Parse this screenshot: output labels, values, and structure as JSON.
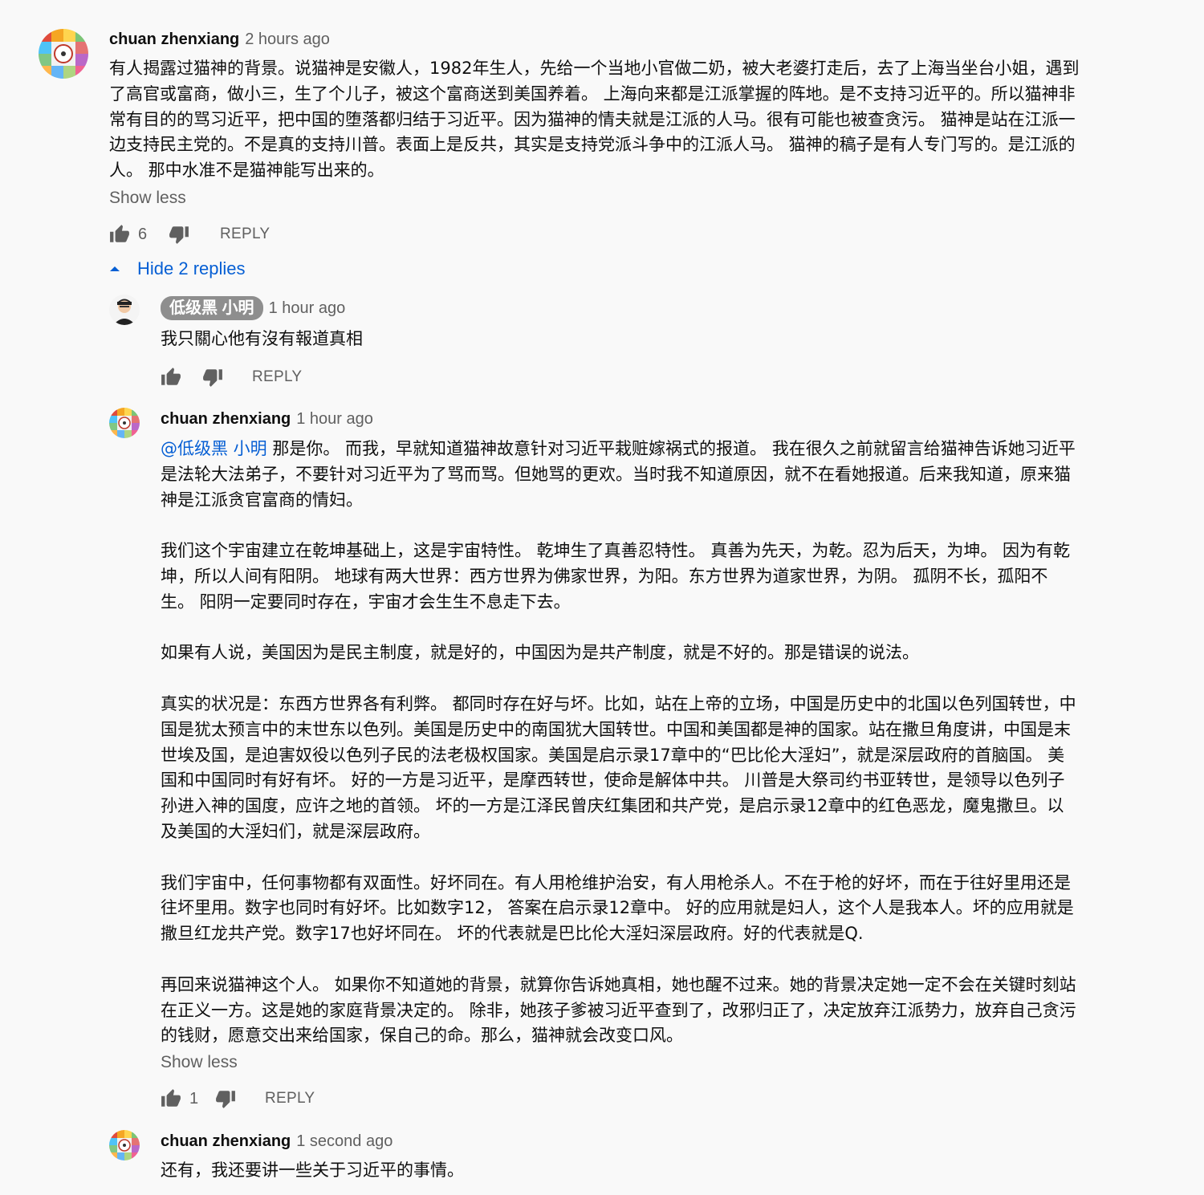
{
  "comment": {
    "author": "chuan zhenxiang",
    "time": "2 hours ago",
    "paragraphs": [
      "有人揭露过猫神的背景。说猫神是安徽人，1982年生人，先给一个当地小官做二奶，被大老婆打走后，去了上海当坐台小姐，遇到了高官或富商，做小三，生了个儿子，被这个富商送到美国养着。 上海向来都是江派掌握的阵地。是不支持习近平的。所以猫神非常有目的的骂习近平，把中国的堕落都归结于习近平。因为猫神的情夫就是江派的人马。很有可能也被查贪污。 猫神是站在江派一边支持民主党的。不是真的支持川普。表面上是反共，其实是支持党派斗争中的江派人马。 猫神的稿子是有人专门写的。是江派的人。 那中水准不是猫神能写出来的。"
    ],
    "show_less": "Show less",
    "likes": "6",
    "reply_label": "REPLY"
  },
  "replies_toggle": {
    "label": "Hide 2 replies"
  },
  "reply1": {
    "author": "低级黑 小明",
    "time": "1 hour ago",
    "text": "我只關心他有沒有報道真相",
    "reply_label": "REPLY"
  },
  "reply2": {
    "author": "chuan zhenxiang",
    "time": "1 hour ago",
    "mention": "@低级黑 小明",
    "p1": " 那是你。 而我，早就知道猫神故意针对习近平栽赃嫁祸式的报道。 我在很久之前就留言给猫神告诉她习近平是法轮大法弟子，不要针对习近平为了骂而骂。但她骂的更欢。当时我不知道原因，就不在看她报道。后来我知道，原来猫神是江派贪官富商的情妇。",
    "p2": "我们这个宇宙建立在乾坤基础上，这是宇宙特性。 乾坤生了真善忍特性。 真善为先天，为乾。忍为后天，为坤。 因为有乾坤，所以人间有阳阴。 地球有两大世界：西方世界为佛家世界，为阳。东方世界为道家世界，为阴。 孤阴不长，孤阳不生。 阳阴一定要同时存在，宇宙才会生生不息走下去。",
    "p3": "如果有人说，美国因为是民主制度，就是好的，中国因为是共产制度，就是不好的。那是错误的说法。",
    "p4": "真实的状况是：东西方世界各有利弊。 都同时存在好与坏。比如，站在上帝的立场，中国是历史中的北国以色列国转世，中国是犹太预言中的末世东以色列。美国是历史中的南国犹大国转世。中国和美国都是神的国家。站在撒旦角度讲，中国是末世埃及国，是迫害奴役以色列子民的法老极权国家。美国是启示录17章中的“巴比伦大淫妇”，就是深层政府的首脑国。 美国和中国同时有好有坏。 好的一方是习近平，是摩西转世，使命是解体中共。 川普是大祭司约书亚转世，是领导以色列子孙进入神的国度，应许之地的首领。 坏的一方是江泽民曾庆红集团和共产党，是启示录12章中的红色恶龙，魔鬼撒旦。以及美国的大淫妇们，就是深层政府。",
    "p5": "我们宇宙中，任何事物都有双面性。好坏同在。有人用枪维护治安，有人用枪杀人。不在于枪的好坏，而在于往好里用还是往坏里用。数字也同时有好坏。比如数字12， 答案在启示录12章中。 好的应用就是妇人，这个人是我本人。坏的应用就是撒旦红龙共产党。数字17也好坏同在。 坏的代表就是巴比伦大淫妇深层政府。好的代表就是Q.",
    "p6": "再回来说猫神这个人。 如果你不知道她的背景，就算你告诉她真相，她也醒不过来。她的背景决定她一定不会在关键时刻站在正义一方。这是她的家庭背景决定的。 除非，她孩子爹被习近平查到了，改邪归正了，决定放弃江派势力，放弃自己贪污的钱财，愿意交出来给国家，保自己的命。那么，猫神就会改变口风。",
    "show_less": "Show less",
    "likes": "1",
    "reply_label": "REPLY"
  },
  "reply3": {
    "author": "chuan zhenxiang",
    "time": "1 second ago",
    "text": "还有，我还要讲一些关于习近平的事情。"
  },
  "colors": {
    "link": "#065fd4",
    "meta": "#606060",
    "text": "#0f0f0f",
    "background": "#f9f9f9"
  },
  "icons": [
    "thumb-up-icon",
    "thumb-down-icon",
    "caret-up-icon",
    "avatar-image"
  ]
}
